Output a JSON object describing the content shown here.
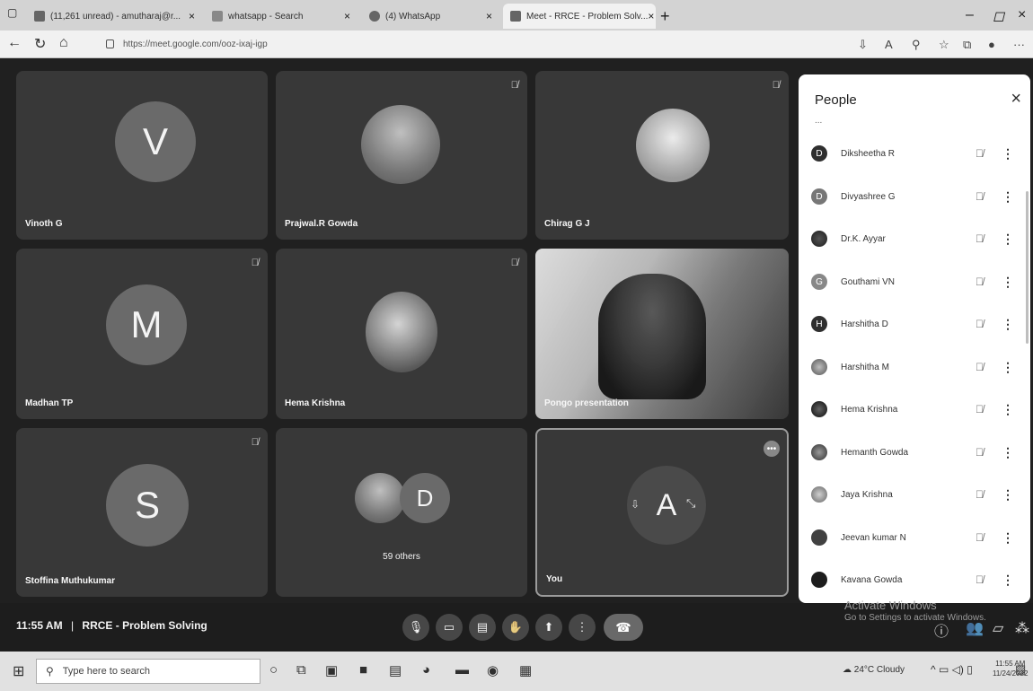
{
  "browser": {
    "tabs": [
      {
        "label": "(11,261 unread) - amutharaj@r...",
        "active": false
      },
      {
        "label": "whatsapp - Search",
        "active": false
      },
      {
        "label": "(4) WhatsApp",
        "active": false
      },
      {
        "label": "Meet - RRCE - Problem Solv...",
        "active": true
      }
    ],
    "new_tab": "+",
    "url": "https://meet.google.com/ooz-ixaj-igp"
  },
  "tiles": [
    {
      "name": "Vinoth G",
      "initial": "V",
      "muted": false
    },
    {
      "name": "Prajwal.R Gowda",
      "initial": "",
      "muted": true
    },
    {
      "name": "Chirag G J",
      "initial": "",
      "muted": true
    },
    {
      "name": "Madhan TP",
      "initial": "M",
      "muted": true
    },
    {
      "name": "Hema Krishna",
      "initial": "",
      "muted": true
    },
    {
      "name": "Pongo presentation",
      "initial": "",
      "muted": false
    },
    {
      "name": "Stoffina Muthukumar",
      "initial": "S",
      "muted": true
    },
    {
      "name": "",
      "initial": "D",
      "caption": "59 others",
      "muted": false
    },
    {
      "name": "You",
      "initial": "A",
      "muted": false
    }
  ],
  "people_panel": {
    "title": "People",
    "ellipsis": "...",
    "participants": [
      {
        "name": "Dikshеetha R",
        "initial": "D"
      },
      {
        "name": "Divyashree G",
        "initial": "D"
      },
      {
        "name": "Dr.K. Ayyar",
        "initial": ""
      },
      {
        "name": "Gouthami VN",
        "initial": "G"
      },
      {
        "name": "Harshitha D",
        "initial": "H"
      },
      {
        "name": "Harshitha M",
        "initial": ""
      },
      {
        "name": "Hema Krishna",
        "initial": ""
      },
      {
        "name": "Hemanth Gowda",
        "initial": ""
      },
      {
        "name": "Jaya Krishna",
        "initial": ""
      },
      {
        "name": "Jeevan kumar N",
        "initial": ""
      },
      {
        "name": "Kavana Gowda",
        "initial": ""
      }
    ]
  },
  "controls": {
    "time": "11:55 AM",
    "separator": "|",
    "meeting_title": "RRCE - Problem Solving"
  },
  "watermark": {
    "title": "Activate Windows",
    "subtitle": "Go to Settings to activate Windows."
  },
  "taskbar": {
    "search_placeholder": "Type here to search",
    "weather": "24°C Cloudy",
    "time": "11:55 AM",
    "date": "11/24/2022"
  }
}
